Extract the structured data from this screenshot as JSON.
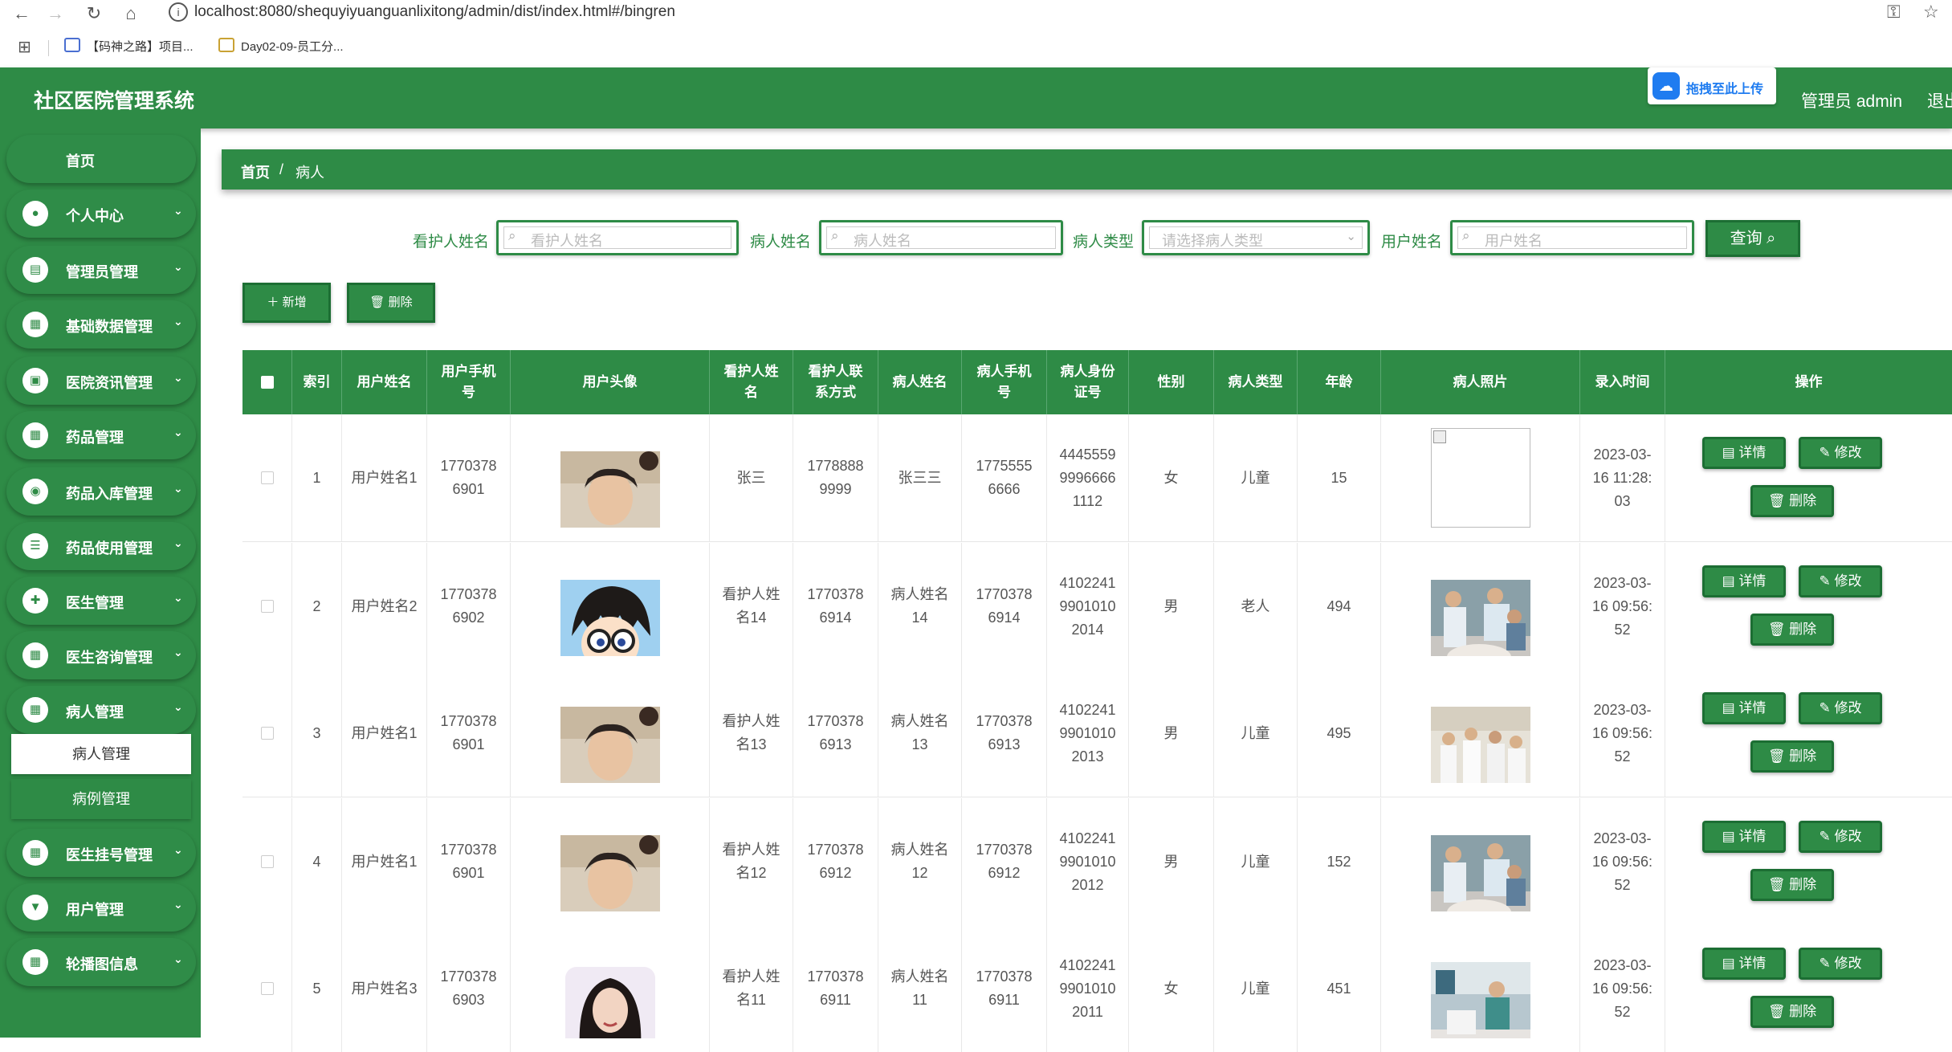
{
  "browser": {
    "url": "localhost:8080/shequyiyuanguanlixitong/admin/dist/index.html#/bingren",
    "bookmarks": [
      "【码神之路】项目...",
      "Day02-09-员工分..."
    ]
  },
  "header": {
    "title": "社区医院管理系统",
    "upload_label": "拖拽至此上传",
    "user_label": "管理员 admin",
    "logout_label": "退出"
  },
  "sidebar": {
    "home": "首页",
    "items": [
      {
        "label": "个人中心",
        "icon": "person-icon"
      },
      {
        "label": "管理员管理",
        "icon": "clipboard-icon"
      },
      {
        "label": "基础数据管理",
        "icon": "grid-icon"
      },
      {
        "label": "医院资讯管理",
        "icon": "briefcase-icon"
      },
      {
        "label": "药品管理",
        "icon": "grid-icon"
      },
      {
        "label": "药品入库管理",
        "icon": "bulb-icon"
      },
      {
        "label": "药品使用管理",
        "icon": "list-icon"
      },
      {
        "label": "医生管理",
        "icon": "doctor-icon"
      },
      {
        "label": "医生咨询管理",
        "icon": "grid-icon"
      },
      {
        "label": "病人管理",
        "icon": "grid-icon"
      },
      {
        "label": "医生挂号管理",
        "icon": "grid-icon"
      },
      {
        "label": "用户管理",
        "icon": "user-card-icon"
      },
      {
        "label": "轮播图信息",
        "icon": "grid-icon"
      }
    ],
    "sub_items": [
      "病人管理",
      "病例管理"
    ]
  },
  "breadcrumb": {
    "home": "首页",
    "separator": "/",
    "current": "病人"
  },
  "search": {
    "caretaker_label": "看护人姓名",
    "caretaker_placeholder": "看护人姓名",
    "patient_label": "病人姓名",
    "patient_placeholder": "病人姓名",
    "type_label": "病人类型",
    "type_placeholder": "请选择病人类型",
    "user_label": "用户姓名",
    "user_placeholder": "用户姓名",
    "query_button": "查询"
  },
  "actions": {
    "add": "新增",
    "delete": "删除"
  },
  "table": {
    "columns": [
      "",
      "索引",
      "用户姓名",
      "用户手机\n号",
      "用户头像",
      "看护人姓\n名",
      "看护人联\n系方式",
      "病人姓名",
      "病人手机\n号",
      "病人身份\n证号",
      "性别",
      "病人类型",
      "年龄",
      "病人照片",
      "录入时间",
      "操作"
    ],
    "rows": [
      {
        "index": "1",
        "user_name": "用户姓名1",
        "user_phone": "1770378\n6901",
        "caretaker": "张三",
        "caretaker_phone": "1778888\n9999",
        "patient_name": "张三三",
        "patient_phone": "1775555\n6666",
        "id_card": "4445559\n9996666\n1112",
        "gender": "女",
        "type": "儿童",
        "age": "15",
        "time": "2023-03-\n16 11:28:\n03"
      },
      {
        "index": "2",
        "user_name": "用户姓名2",
        "user_phone": "1770378\n6902",
        "caretaker": "看护人姓\n名14",
        "caretaker_phone": "1770378\n6914",
        "patient_name": "病人姓名\n14",
        "patient_phone": "1770378\n6914",
        "id_card": "4102241\n9901010\n2014",
        "gender": "男",
        "type": "老人",
        "age": "494",
        "time": "2023-03-\n16 09:56:\n52"
      },
      {
        "index": "3",
        "user_name": "用户姓名1",
        "user_phone": "1770378\n6901",
        "caretaker": "看护人姓\n名13",
        "caretaker_phone": "1770378\n6913",
        "patient_name": "病人姓名\n13",
        "patient_phone": "1770378\n6913",
        "id_card": "4102241\n9901010\n2013",
        "gender": "男",
        "type": "儿童",
        "age": "495",
        "time": "2023-03-\n16 09:56:\n52"
      },
      {
        "index": "4",
        "user_name": "用户姓名1",
        "user_phone": "1770378\n6901",
        "caretaker": "看护人姓\n名12",
        "caretaker_phone": "1770378\n6912",
        "patient_name": "病人姓名\n12",
        "patient_phone": "1770378\n6912",
        "id_card": "4102241\n9901010\n2012",
        "gender": "男",
        "type": "儿童",
        "age": "152",
        "time": "2023-03-\n16 09:56:\n52"
      },
      {
        "index": "5",
        "user_name": "用户姓名3",
        "user_phone": "1770378\n6903",
        "caretaker": "看护人姓\n名11",
        "caretaker_phone": "1770378\n6911",
        "patient_name": "病人姓名\n11",
        "patient_phone": "1770378\n6911",
        "id_card": "4102241\n9901010\n2011",
        "gender": "女",
        "type": "儿童",
        "age": "451",
        "time": "2023-03-\n16 09:56:\n52"
      }
    ],
    "row_actions": {
      "detail": "详情",
      "edit": "修改",
      "delete": "删除"
    }
  },
  "colors": {
    "primary": "#2e8b46",
    "primary_dark": "#1c6e33"
  }
}
